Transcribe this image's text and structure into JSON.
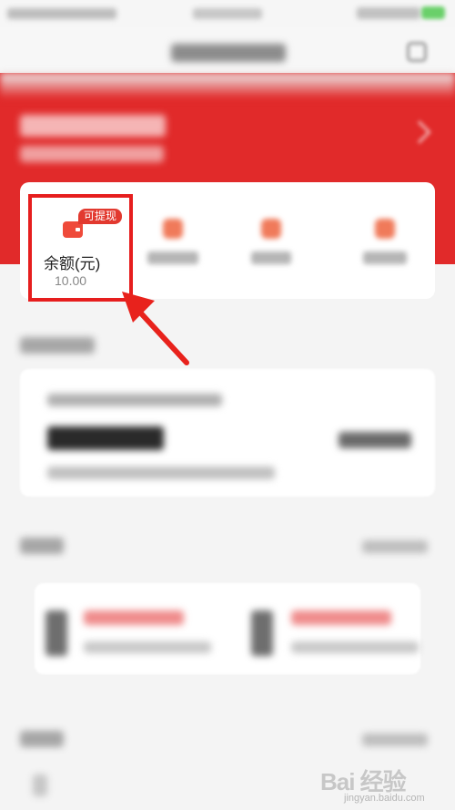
{
  "balance": {
    "badge": "可提现",
    "label": "余额(元)",
    "value": "10.00",
    "icon": "wallet-icon"
  },
  "watermark": {
    "brand": "Bai 经验",
    "url": "jingyan.baidu.com"
  },
  "colors": {
    "header_red": "#e12a2a",
    "highlight_red": "#e61e1e",
    "badge_red": "#e2392f",
    "wallet_red": "#ef4a3a"
  }
}
